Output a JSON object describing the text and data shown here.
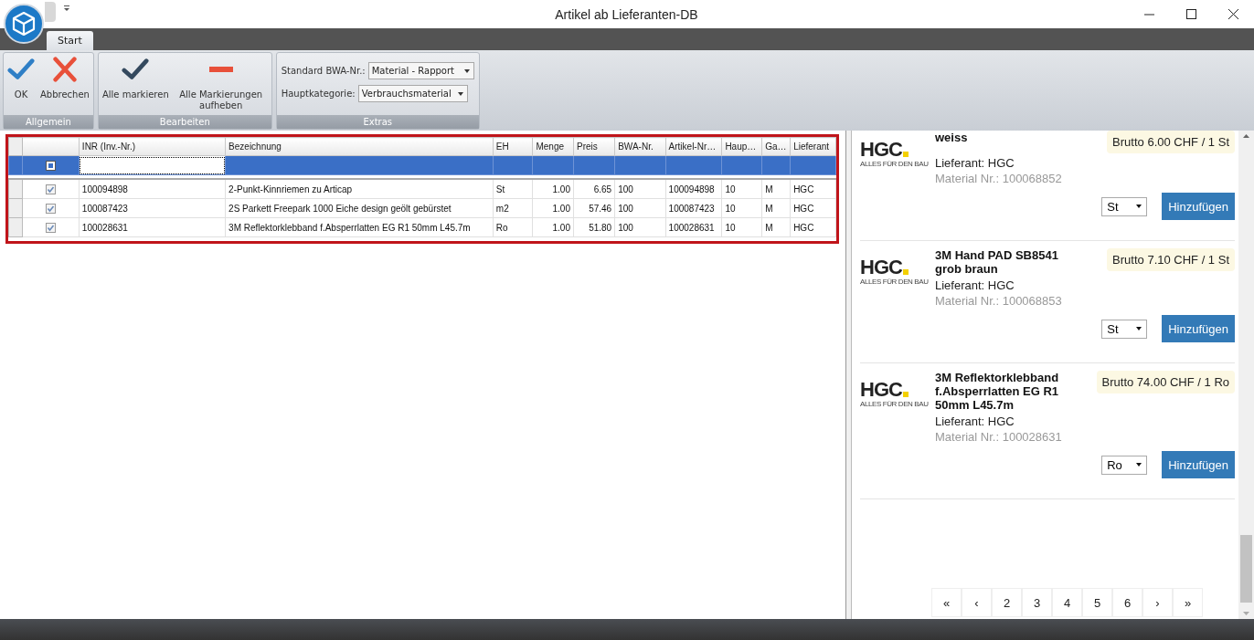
{
  "window": {
    "title": "Artikel ab Lieferanten-DB"
  },
  "tabs": [
    {
      "label": "Start",
      "selected": true
    }
  ],
  "ribbon": {
    "groups": [
      {
        "label": "Allgemein",
        "buttons": [
          {
            "label": "OK",
            "kind": "confirm"
          },
          {
            "label": "Abbrechen",
            "kind": "cancel"
          }
        ]
      },
      {
        "label": "Bearbeiten",
        "buttons": [
          {
            "label": "Alle markieren",
            "kind": "mark_all"
          },
          {
            "label": "Alle Markierungen aufheben",
            "kind": "unmark_all"
          }
        ]
      },
      {
        "label": "Extras",
        "fields": [
          {
            "label": "Standard BWA-Nr.:",
            "value": "Material - Rapport"
          },
          {
            "label": "Hauptkategorie:",
            "value": "Verbrauchsmaterial"
          }
        ]
      }
    ]
  },
  "grid": {
    "columns": [
      {
        "label": "INR (Inv.-Nr.)",
        "kind": "text"
      },
      {
        "label": "Bezeichnung",
        "kind": "text"
      },
      {
        "label": "EH",
        "kind": "text"
      },
      {
        "label": "Menge",
        "kind": "number"
      },
      {
        "label": "Preis",
        "kind": "number"
      },
      {
        "label": "BWA-Nr.",
        "kind": "text"
      },
      {
        "label": "Artikel-Nr…",
        "kind": "text"
      },
      {
        "label": "Haup…",
        "kind": "text"
      },
      {
        "label": "Ga…",
        "kind": "text"
      },
      {
        "label": "Lieferant",
        "kind": "text"
      }
    ],
    "new_row": {
      "selected": true
    },
    "rows": [
      {
        "checked": true,
        "cells": [
          "100094898",
          "2-Punkt-Kinnriemen zu Articap",
          "St",
          "1.00",
          "6.65",
          "100",
          "100094898",
          "10",
          "M",
          "HGC"
        ]
      },
      {
        "checked": true,
        "cells": [
          "100087423",
          "2S Parkett Freepark 1000 Eiche design geölt gebürstet",
          "m2",
          "1.00",
          "57.46",
          "100",
          "100087423",
          "10",
          "M",
          "HGC"
        ]
      },
      {
        "checked": true,
        "cells": [
          "100028631",
          "3M Reflektorklebband f.Absperrlatten EG R1 50mm L45.7m",
          "Ro",
          "1.00",
          "51.80",
          "100",
          "100028631",
          "10",
          "M",
          "HGC"
        ]
      }
    ]
  },
  "products": [
    {
      "logo": "HGC",
      "logo_tagline": "ALLES FÜR DEN BAU",
      "title": "weiss",
      "supplier": "Lieferant: HGC",
      "material": "Material Nr.: 100068852",
      "price": "Brutto 6.00 CHF / 1 St",
      "unit": "St",
      "button": "Hinzufügen"
    },
    {
      "logo": "HGC",
      "logo_tagline": "ALLES FÜR DEN BAU",
      "title": "3M Hand PAD SB8541 grob braun",
      "supplier": "Lieferant: HGC",
      "material": "Material Nr.: 100068853",
      "price": "Brutto 7.10 CHF / 1 St",
      "unit": "St",
      "button": "Hinzufügen"
    },
    {
      "logo": "HGC",
      "logo_tagline": "ALLES FÜR DEN BAU",
      "title": "3M Reflektorklebband f.Absperrlatten EG R1 50mm L45.7m",
      "supplier": "Lieferant: HGC",
      "material": "Material Nr.: 100028631",
      "price": "Brutto 74.00 CHF / 1 Ro",
      "unit": "Ro",
      "button": "Hinzufügen"
    }
  ],
  "pagination": [
    "«",
    "‹",
    "2",
    "3",
    "4",
    "5",
    "6",
    "›",
    "»"
  ]
}
